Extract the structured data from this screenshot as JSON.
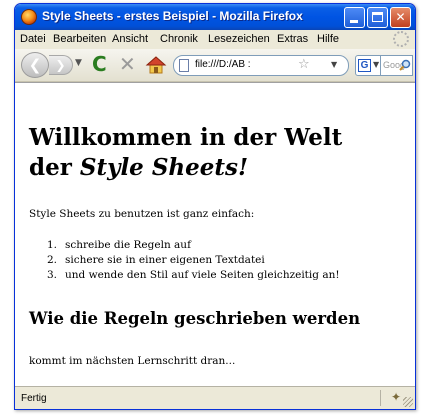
{
  "window": {
    "title": "Style Sheets - erstes Beispiel - Mozilla Firefox"
  },
  "menu": {
    "items": [
      "Datei",
      "Bearbeiten",
      "Ansicht",
      "Chronik",
      "Lesezeichen",
      "Extras",
      "Hilfe"
    ]
  },
  "navbar": {
    "url": "file:///D:/AB :",
    "search_placeholder": "Goog",
    "search_engine_icon": "G"
  },
  "page": {
    "heading_line1": "Willkommen in der Welt",
    "heading_line2_prefix": "der ",
    "heading_line2_em": "Style Sheets",
    "heading_line2_suffix": "!",
    "intro": "Style Sheets zu benutzen ist ganz einfach:",
    "list": [
      {
        "num": "1.",
        "text": "schreibe die Regeln auf"
      },
      {
        "num": "2.",
        "text": "sichere sie in einer eigenen Textdatei"
      },
      {
        "num": "3.",
        "text": "und wende den Stil auf viele Seiten gleichzeitig an!"
      }
    ],
    "subheading": "Wie die Regeln geschrieben werden",
    "outro": "kommt im nächsten Lernschritt dran..."
  },
  "status": {
    "text": "Fertig"
  },
  "colors": {
    "titlebar": "#0054e3",
    "chrome": "#ece9d8",
    "reload": "#2b7d20",
    "stop": "#9a9a9a"
  },
  "icons": [
    "firefox-icon",
    "back-icon",
    "forward-icon",
    "reload-icon",
    "stop-icon",
    "home-icon",
    "page-icon",
    "star-icon",
    "google-icon",
    "magnifier-icon",
    "puzzle-icon"
  ]
}
